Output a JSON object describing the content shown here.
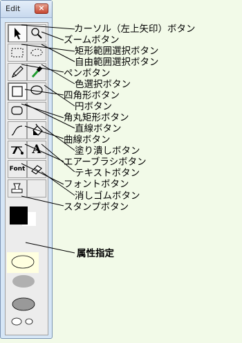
{
  "window": {
    "title": "Edit",
    "close_glyph": "×"
  },
  "tools": [
    {
      "name": "cursor-tool-button",
      "icon": "arrow-cursor-icon",
      "selected": true
    },
    {
      "name": "zoom-tool-button",
      "icon": "magnifier-icon"
    },
    {
      "name": "rect-select-tool-button",
      "icon": "dashed-rectangle-icon"
    },
    {
      "name": "free-select-tool-button",
      "icon": "lasso-icon"
    },
    {
      "name": "pen-tool-button",
      "icon": "pencil-icon"
    },
    {
      "name": "color-picker-tool-button",
      "icon": "eyedropper-icon"
    },
    {
      "name": "rectangle-tool-button",
      "icon": "rectangle-icon"
    },
    {
      "name": "ellipse-tool-button",
      "icon": "ellipse-icon"
    },
    {
      "name": "rounded-rect-tool-button",
      "icon": "rounded-rectangle-icon"
    },
    {
      "name": "line-tool-button",
      "icon": "line-icon"
    },
    {
      "name": "curve-tool-button",
      "icon": "curve-icon"
    },
    {
      "name": "fill-tool-button",
      "icon": "paint-bucket-icon"
    },
    {
      "name": "airbrush-tool-button",
      "icon": "airbrush-icon"
    },
    {
      "name": "text-tool-button",
      "icon": "text-a-icon",
      "glyph": "A"
    },
    {
      "name": "font-tool-button",
      "icon": "font-icon",
      "glyph": "Font"
    },
    {
      "name": "eraser-tool-button",
      "icon": "eraser-icon"
    },
    {
      "name": "stamp-tool-button",
      "icon": "stamp-icon"
    }
  ],
  "colors": {
    "foreground": "#000000",
    "background": "#ffffff",
    "attr_fill": "#ffffe0",
    "gray_light": "#b0b0b0",
    "gray_dark": "#999999"
  },
  "labels": {
    "cursor": "カーソル（左上矢印）ボタン",
    "zoom": "ズームボタン",
    "rect_select": "矩形範囲選択ボタン",
    "free_select": "自由範囲選択ボタン",
    "pen": "ペンボタン",
    "color_picker": "色選択ボタン",
    "rectangle": "四角形ボタン",
    "ellipse": "円ボタン",
    "rounded_rect": "角丸矩形ボタン",
    "line": "直線ボタン",
    "curve": "曲線ボタン",
    "fill": "塗り潰しボタン",
    "airbrush": "エアーブラシボタン",
    "text": "テキストボタン",
    "font": "フォントボタン",
    "eraser": "消しゴムボタン",
    "stamp": "スタンプボタン",
    "attributes": "属性指定"
  }
}
